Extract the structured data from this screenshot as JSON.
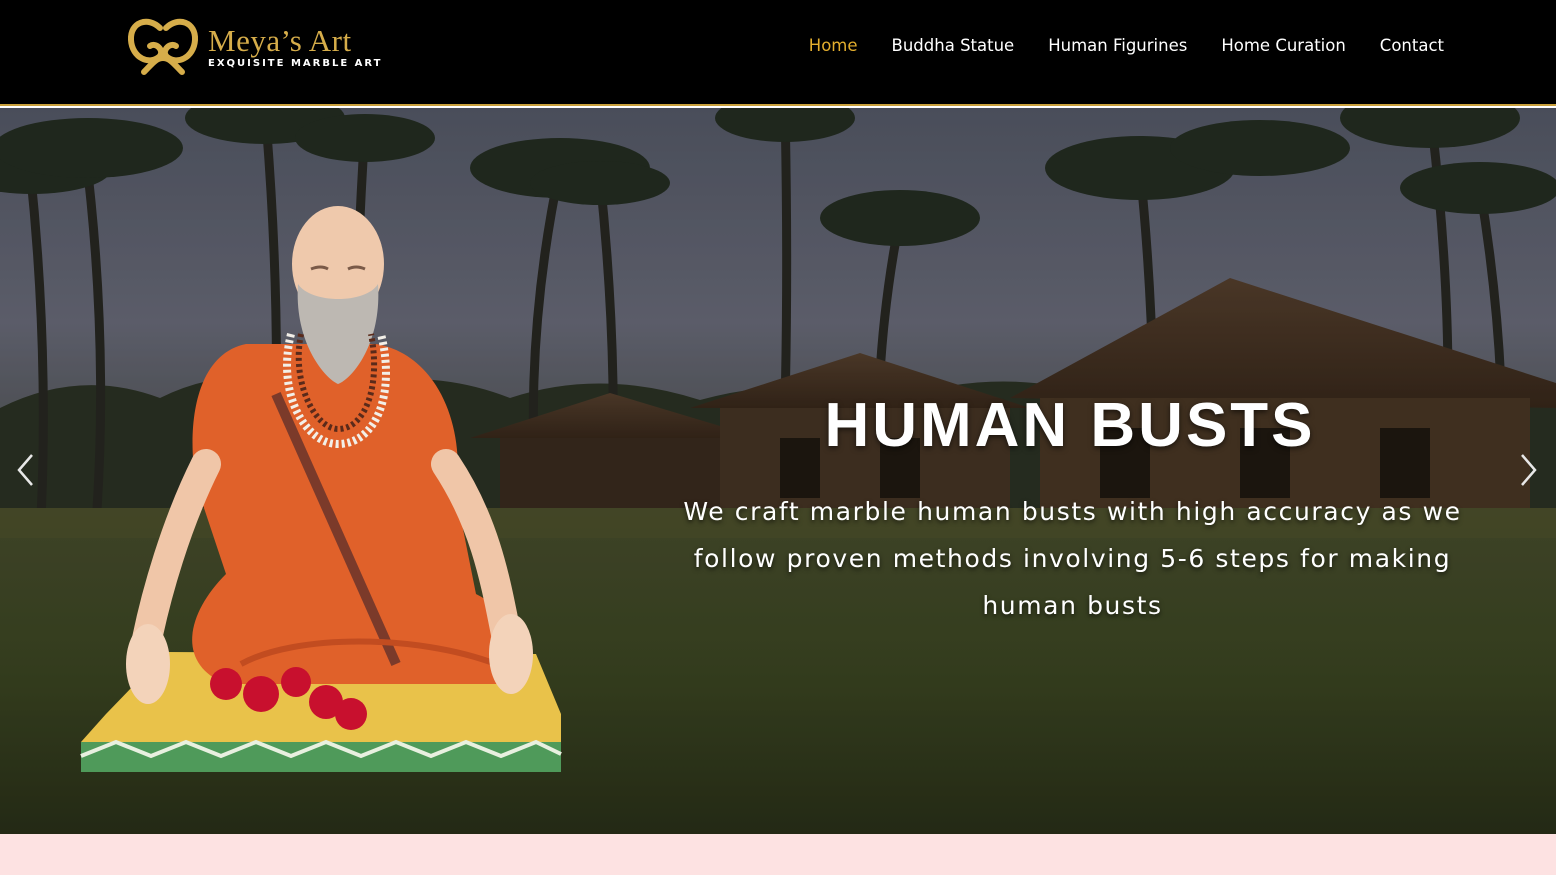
{
  "brand": {
    "name": "Meya’s Art",
    "tagline": "EXQUISITE MARBLE ART",
    "color": "#d6ad4a"
  },
  "nav": {
    "items": [
      {
        "label": "Home",
        "active": true
      },
      {
        "label": "Buddha Statue",
        "active": false
      },
      {
        "label": "Human Figurines",
        "active": false
      },
      {
        "label": "Home Curation",
        "active": false
      },
      {
        "label": "Contact",
        "active": false
      }
    ],
    "active_color": "#e3ae2e"
  },
  "hero": {
    "title": "HUMAN BUSTS",
    "description": "We craft marble human busts with high accuracy as we follow proven methods involving 5-6 steps for making human busts",
    "prev_icon": "chevron-left-icon",
    "next_icon": "chevron-right-icon"
  },
  "colors": {
    "header_bg": "#000000",
    "header_border": "#c9a03c",
    "band_bg": "#fde2e2"
  }
}
